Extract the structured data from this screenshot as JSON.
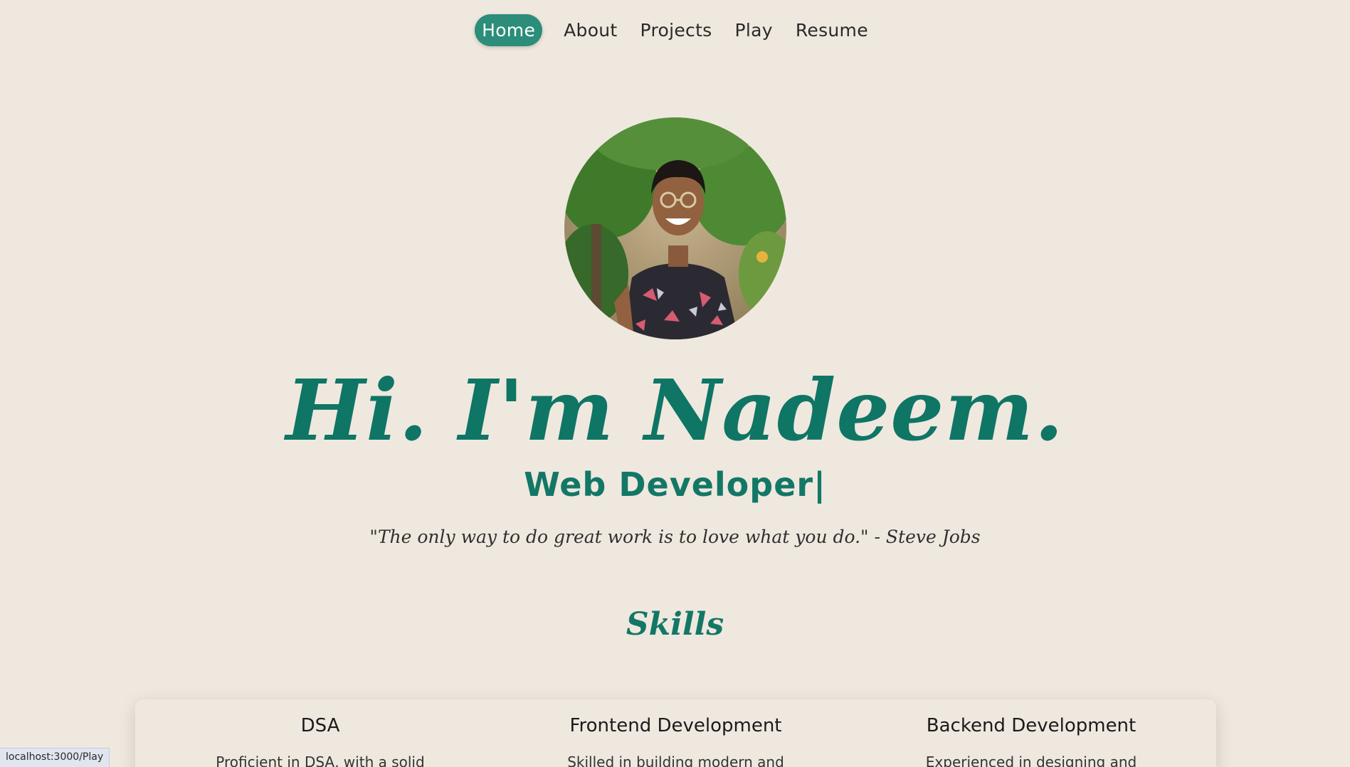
{
  "nav": {
    "items": [
      {
        "label": "Home",
        "active": true
      },
      {
        "label": "About",
        "active": false
      },
      {
        "label": "Projects",
        "active": false
      },
      {
        "label": "Play",
        "active": false
      },
      {
        "label": "Resume",
        "active": false
      }
    ]
  },
  "hero": {
    "title": "Hi. I'm Nadeem.",
    "role": "Web Developer|",
    "quote": "\"The only way to do great work is to love what you do.\" - Steve Jobs"
  },
  "skills": {
    "heading": "Skills",
    "items": [
      {
        "title": "DSA",
        "description": "Proficient in DSA, with a solid"
      },
      {
        "title": "Frontend Development",
        "description": "Skilled in building modern and"
      },
      {
        "title": "Backend Development",
        "description": "Experienced in designing and"
      }
    ]
  },
  "status_bar": {
    "url": "localhost:3000/Play"
  },
  "colors": {
    "background": "#efe8df",
    "accent": "#137766",
    "nav_active": "#2b8d7a"
  }
}
